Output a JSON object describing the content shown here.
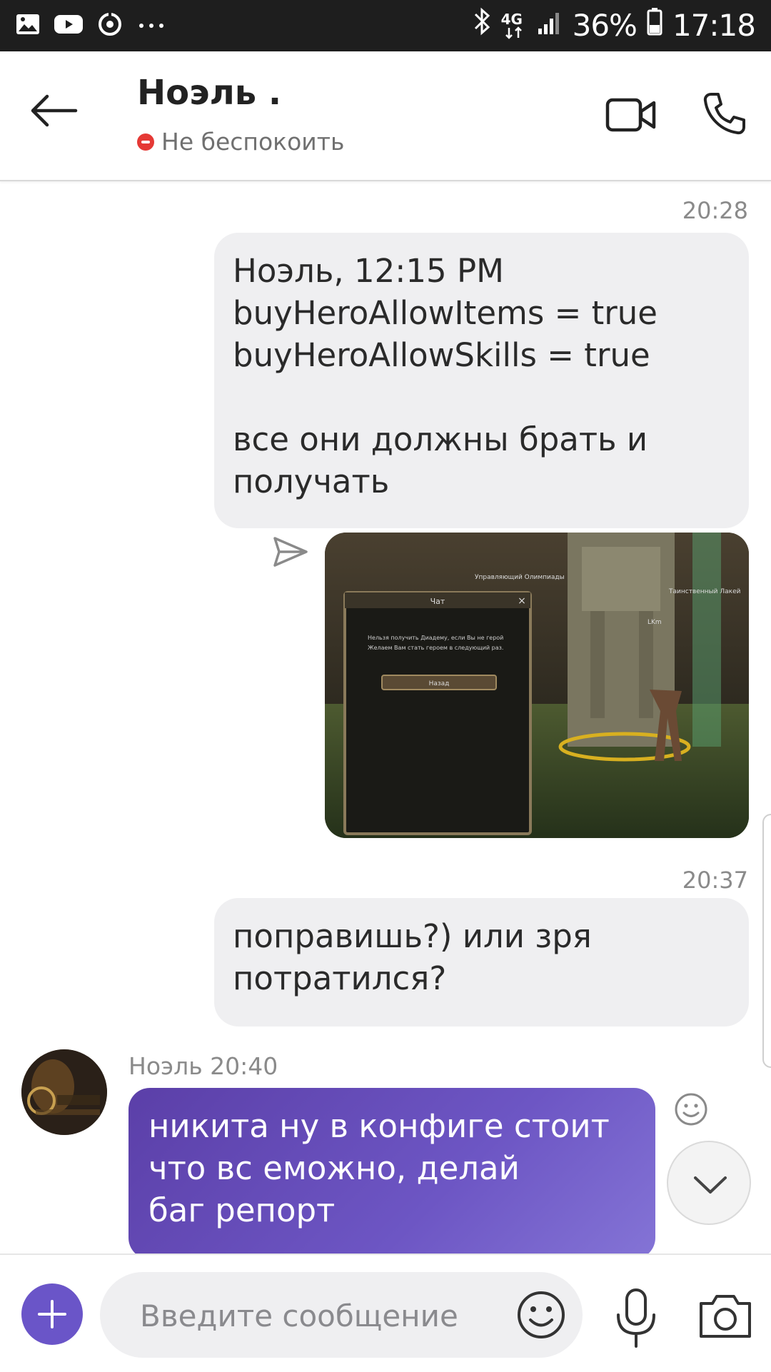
{
  "status_bar": {
    "icons": [
      "gallery-icon",
      "youtube-icon",
      "sync-icon",
      "more-dots-icon"
    ],
    "right_icons": [
      "bluetooth-icon",
      "network-4g-icon",
      "signal-icon",
      "battery-icon"
    ],
    "network": "4G",
    "battery": "36%",
    "time": "17:18"
  },
  "header": {
    "contact_name": "Ноэль .",
    "status_text": "Не беспокоить",
    "status_color": "#e53935"
  },
  "messages": [
    {
      "time": "20:28"
    },
    {
      "text": "Ноэль, 12:15 PM\nbuyHeroAllowItems = true\nbuyHeroAllowSkills = true\n\nвсе они должны брать и\nполучать"
    },
    {
      "image": {
        "npc_label_1": "Управляющий Олимпиады",
        "npc_label_2": "Таинственный Лакей",
        "player_label": "LKm",
        "dialog_title": "Чат",
        "dialog_close": "×",
        "dialog_text": "Нельзя получить Диадему, если Вы не герой\nЖелаем Вам стать героем в следующий раз.",
        "dialog_button": "Назад"
      }
    },
    {
      "time": "20:37"
    },
    {
      "text": "поправишь?) или зря\nпотратился?"
    },
    {
      "sender": "Ноэль 20:40",
      "text": "никита ну в конфиге стоит\nчто вс еможно, делай\nбаг репорт"
    }
  ],
  "composer": {
    "placeholder": "Введите сообщение"
  },
  "colors": {
    "accent": "#6a55c8",
    "incoming_bubble": "#6d56c4",
    "outgoing_bubble": "#efeff1"
  }
}
